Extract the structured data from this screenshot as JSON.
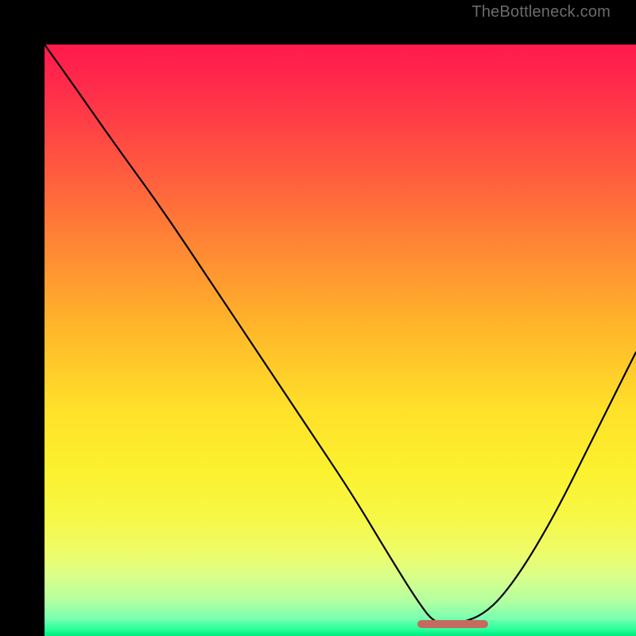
{
  "watermark": "TheBottleneck.com",
  "chart_data": {
    "type": "line",
    "title": "",
    "xlabel": "",
    "ylabel": "",
    "xlim": [
      0,
      100
    ],
    "ylim": [
      0,
      100
    ],
    "grid": false,
    "series": [
      {
        "name": "bottleneck-curve",
        "x": [
          0,
          5,
          12,
          20,
          28,
          36,
          44,
          52,
          58,
          63,
          66,
          70,
          75,
          80,
          86,
          92,
          100
        ],
        "y": [
          100,
          93,
          83,
          72,
          60,
          48,
          36,
          24,
          14,
          6,
          2,
          2,
          4,
          10,
          20,
          32,
          48
        ]
      }
    ],
    "annotations": [
      {
        "name": "trough-band",
        "x_start": 63,
        "x_end": 75,
        "y": 2
      }
    ],
    "background_gradient": {
      "stops": [
        {
          "pos": 0,
          "color": "#ff1a4d"
        },
        {
          "pos": 20,
          "color": "#ff5640"
        },
        {
          "pos": 48,
          "color": "#ffb72a"
        },
        {
          "pos": 72,
          "color": "#fbf12e"
        },
        {
          "pos": 90,
          "color": "#d8ff8a"
        },
        {
          "pos": 100,
          "color": "#00e87a"
        }
      ]
    }
  }
}
